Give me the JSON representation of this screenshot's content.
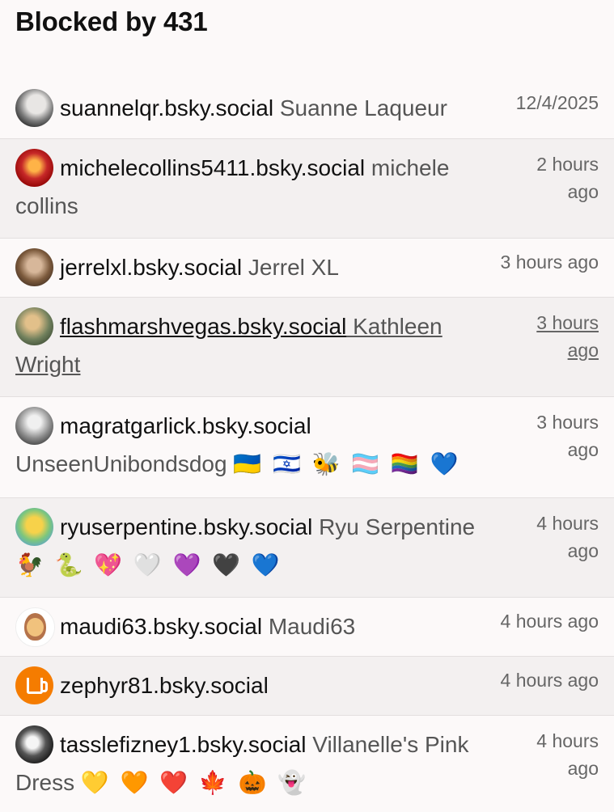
{
  "header": {
    "title": "Blocked by 431"
  },
  "rows": [
    {
      "handle": "suannelqr.bsky.social",
      "name": "Suanne Laqueur",
      "time": "12/4/2025",
      "emojis": ""
    },
    {
      "handle": "michelecollins5411.bsky.social",
      "name": "michele collins",
      "time": "2 hours ago",
      "emojis": ""
    },
    {
      "handle": "jerrelxl.bsky.social",
      "name": "Jerrel XL",
      "time": "3 hours ago",
      "emojis": ""
    },
    {
      "handle": "flashmarshvegas.bsky.social",
      "name": "Kathleen Wright",
      "time": "3 hours ago",
      "emojis": ""
    },
    {
      "handle": "magratgarlick.bsky.social",
      "name": "UnseenUnibondsdog",
      "time": "3 hours ago",
      "emojis": "🇺🇦 🇮🇱 🐝 🏳️‍⚧️ 🏳️‍🌈 💙"
    },
    {
      "handle": "ryuserpentine.bsky.social",
      "name": "Ryu Serpentine",
      "time": "4 hours ago",
      "emojis": "🐓 🐍 💖 🤍 💜 🖤 💙"
    },
    {
      "handle": "maudi63.bsky.social",
      "name": "Maudi63",
      "time": "4 hours ago",
      "emojis": ""
    },
    {
      "handle": "zephyr81.bsky.social",
      "name": "",
      "time": "4 hours ago",
      "emojis": ""
    },
    {
      "handle": "tasslefizney1.bsky.social",
      "name": "Villanelle's Pink Dress",
      "time": "4 hours ago",
      "emojis": "💛 🧡 ❤️ 🍁 🎃 👻"
    }
  ]
}
